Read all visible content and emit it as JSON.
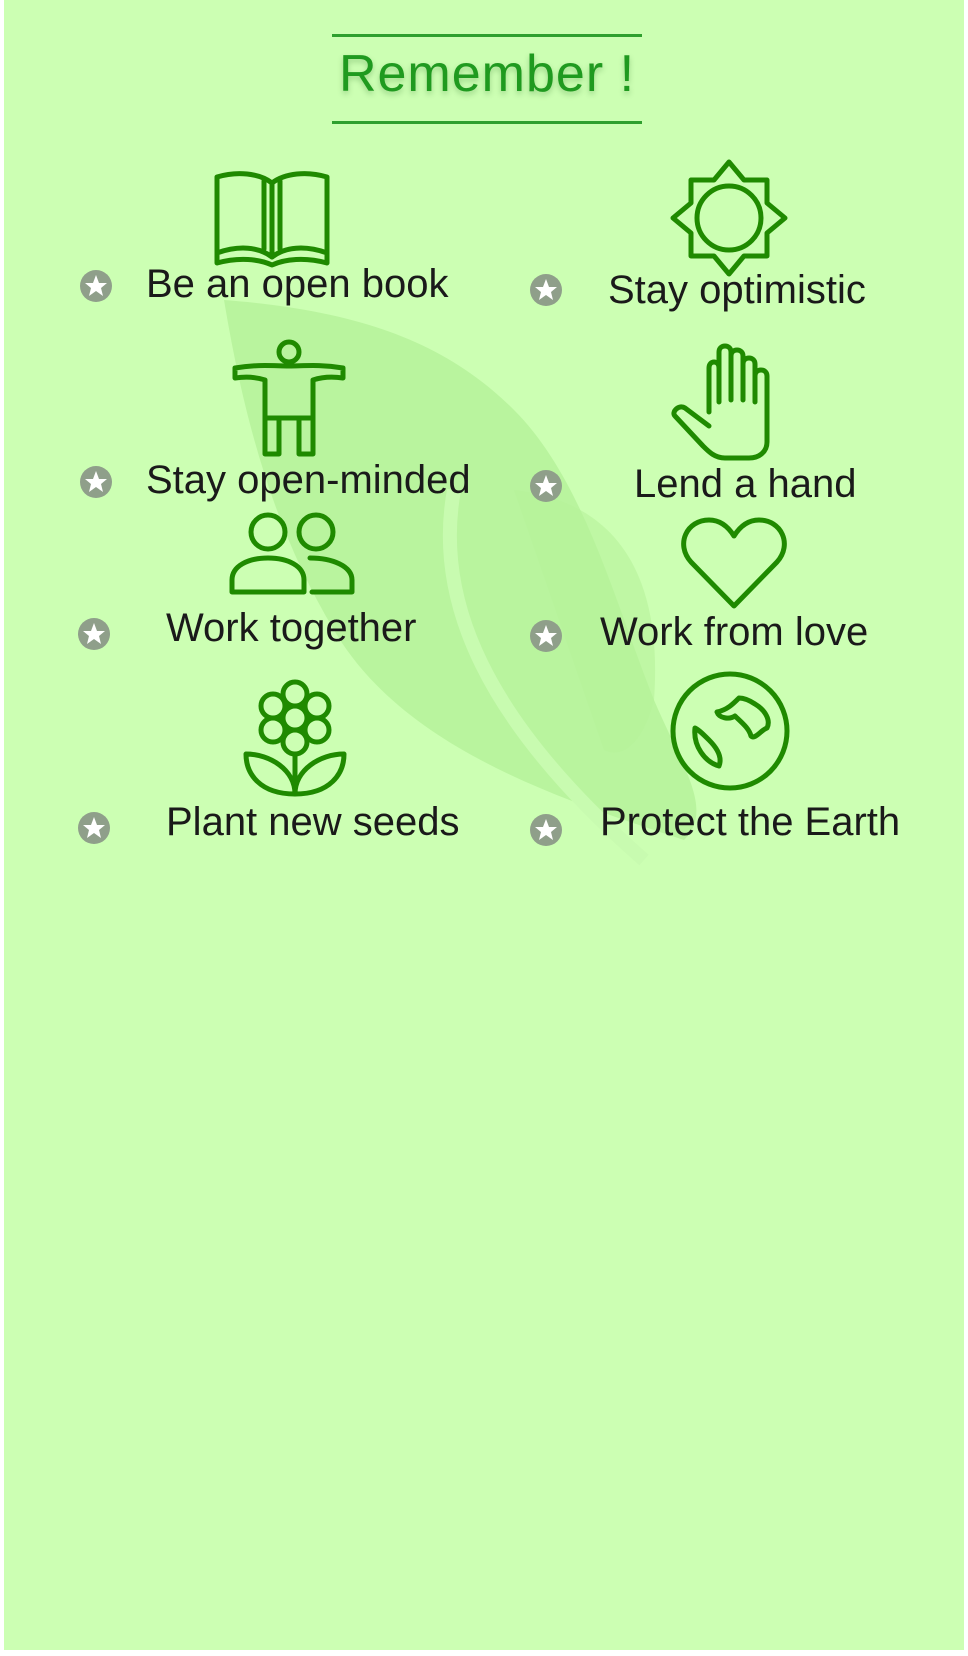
{
  "title": "Remember !",
  "colors": {
    "background": "#ccffb3",
    "accent": "#1f8a00",
    "title": "#1f9a1f",
    "star_badge": "#8f9f8a",
    "text": "#1a1a1a"
  },
  "items": [
    {
      "label": "Be an open book",
      "icon": "open-book-icon"
    },
    {
      "label": "Stay optimistic",
      "icon": "sun-icon"
    },
    {
      "label": "Stay open-minded",
      "icon": "open-arms-person-icon"
    },
    {
      "label": "Lend a hand",
      "icon": "hand-icon"
    },
    {
      "label": "Work together",
      "icon": "people-icon"
    },
    {
      "label": "Work from love",
      "icon": "heart-icon"
    },
    {
      "label": "Plant new seeds",
      "icon": "flower-icon"
    },
    {
      "label": "Protect the Earth",
      "icon": "earth-icon"
    }
  ]
}
